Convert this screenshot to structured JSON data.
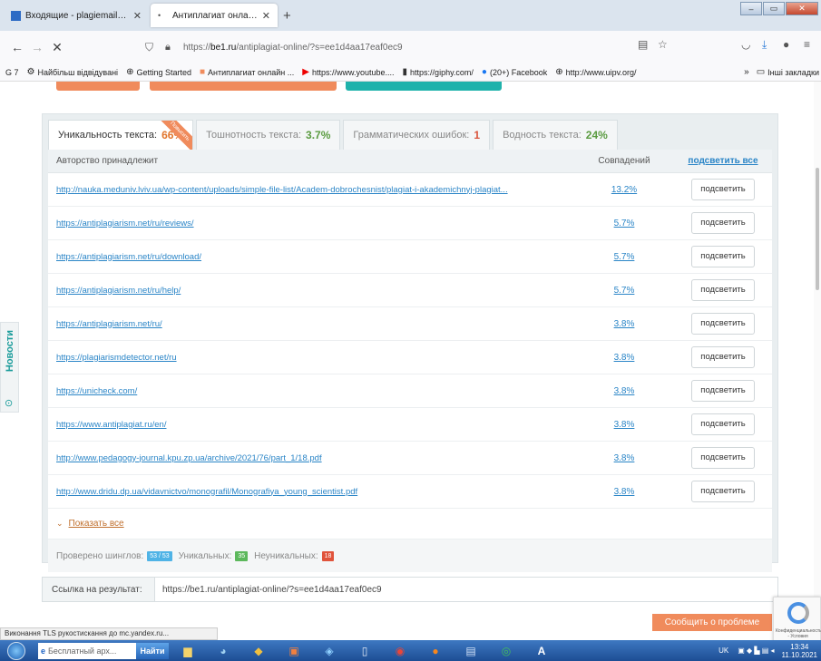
{
  "browser": {
    "tabs": [
      {
        "title": "Входящие - plagiemail@meta.ua",
        "icon": "mail-icon"
      },
      {
        "title": "Антиплагиат онлайн | Проверка",
        "icon": "dot-icon"
      }
    ],
    "new_tab": "+",
    "url_host": "be1.ru",
    "url_prefix": "https://",
    "url_path": "/antiplagiat-online/?s=ee1d4aa17eaf0ec9",
    "bookmarks": [
      {
        "label": "G 7",
        "icon": ""
      },
      {
        "label": "Найбільш відвідувані",
        "icon": "gear-icon"
      },
      {
        "label": "Getting Started",
        "icon": "globe-icon"
      },
      {
        "label": "Антиплагиат онлайн ...",
        "icon": "be-icon"
      },
      {
        "label": "https://www.youtube....",
        "icon": "youtube-icon"
      },
      {
        "label": "https://giphy.com/",
        "icon": "giphy-icon"
      },
      {
        "label": "(20+) Facebook",
        "icon": "facebook-icon"
      },
      {
        "label": "http://www.uipv.org/",
        "icon": "globe-icon"
      }
    ],
    "other_bookmarks": "Інші закладки",
    "status": "Виконання TLS рукостискання до mc.yandex.ru..."
  },
  "tabs": {
    "uniqueness": {
      "label": "Уникальность текста:",
      "value": "66%"
    },
    "nausea": {
      "label": "Тошнотность текста:",
      "value": "3.7%"
    },
    "grammar": {
      "label": "Грамматических ошибок:",
      "value": "1"
    },
    "water": {
      "label": "Водность текста:",
      "value": "24%"
    },
    "ribbon": "Повысить"
  },
  "table": {
    "header_author": "Авторство принадлежит",
    "header_matches": "Совпадений",
    "highlight_all": "подсветить все",
    "rows": [
      {
        "url": "http://nauka.meduniv.lviv.ua/wp-content/uploads/simple-file-list/Academ-dobrochesnist/plagiat-i-akademichnyj-plagiat...",
        "pct": "13.2%",
        "btn": "подсветить"
      },
      {
        "url": "https://antiplagiarism.net/ru/reviews/",
        "pct": "5.7%",
        "btn": "подсветить"
      },
      {
        "url": "https://antiplagiarism.net/ru/download/",
        "pct": "5.7%",
        "btn": "подсветить"
      },
      {
        "url": "https://antiplagiarism.net/ru/help/",
        "pct": "5.7%",
        "btn": "подсветить"
      },
      {
        "url": "https://antiplagiarism.net/ru/",
        "pct": "3.8%",
        "btn": "подсветить"
      },
      {
        "url": "https://plagiarismdetector.net/ru",
        "pct": "3.8%",
        "btn": "подсветить"
      },
      {
        "url": "https://unicheck.com/",
        "pct": "3.8%",
        "btn": "подсветить"
      },
      {
        "url": "https://www.antiplagiat.ru/en/",
        "pct": "3.8%",
        "btn": "подсветить"
      },
      {
        "url": "http://www.pedagogy-journal.kpu.zp.ua/archive/2021/76/part_1/18.pdf",
        "pct": "3.8%",
        "btn": "подсветить"
      },
      {
        "url": "http://www.dridu.dp.ua/vidavnictvo/monografil/Monografiya_young_scientist.pdf",
        "pct": "3.8%",
        "btn": "подсветить"
      }
    ],
    "show_all": "Показать все",
    "checked_label": "Проверено шинглов:",
    "checked_value": "53 / 53",
    "unique_label": "Уникальных:",
    "unique_value": "35",
    "nonunique_label": "Неуникальных:",
    "nonunique_value": "18"
  },
  "result_link": {
    "label": "Ссылка на результат:",
    "value": "https://be1.ru/antiplagiat-online/?s=ee1d4aa17eaf0ec9"
  },
  "sidebar": {
    "label": "Новости"
  },
  "report_button": "Сообщить о проблеме",
  "recaptcha_text": "Конфиденциальность - Условия использования",
  "taskbar": {
    "search_placeholder": "Бесплатный арх...",
    "find_button": "Найти",
    "lang": "UK",
    "time": "13:34",
    "date": "11.10.2021"
  },
  "colors": {
    "accent_orange": "#f08b5c",
    "accent_teal": "#1fb2ab",
    "link_blue": "#2a85c7",
    "badge_blue": "#4fb3e6",
    "badge_green": "#5cb85c",
    "badge_red": "#e0533b"
  }
}
